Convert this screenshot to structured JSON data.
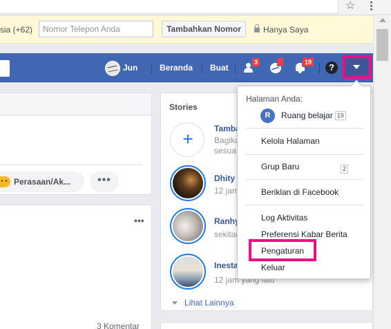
{
  "browser": {
    "star_icon": "star-icon",
    "menu_icon": "three-dot-menu-icon"
  },
  "notice": {
    "country_code_label": "sia (+62)",
    "phone_placeholder": "Nomor Telepon Anda",
    "add_number_button": "Tambahkan Nomor",
    "privacy_label": "Hanya Saya"
  },
  "header": {
    "profile_name": "Jun",
    "home_label": "Beranda",
    "create_label": "Buat",
    "friend_requests_count": "3",
    "messages_count": "",
    "notifications_count": "19",
    "help_label": "?"
  },
  "composer": {
    "feeling_label": "Perasaan/Ak...",
    "more_label": "•••"
  },
  "post": {
    "options_label": "•••",
    "comment_count": "3 Komentar"
  },
  "stories": {
    "title": "Stories",
    "add_story_title": "Tambah",
    "add_story_sub_1": "Bagika",
    "add_story_sub_2": "sesua",
    "items": [
      {
        "name": "Dhity",
        "time": "12 jam"
      },
      {
        "name": "Ranhy",
        "time": "sekitar"
      },
      {
        "name": "Inesta",
        "time": "12 jam yang lalu"
      }
    ],
    "see_more": "Lihat Lainnya"
  },
  "menu": {
    "your_pages_label": "Halaman Anda:",
    "page_initial": "R",
    "page_name": "Ruang belajar",
    "page_count": "19",
    "manage_pages": "Kelola Halaman",
    "new_group": "Grup Baru",
    "new_group_count": "2",
    "advertise": "Beriklan di Facebook",
    "activity_log": "Log Aktivitas",
    "news_feed_prefs": "Preferensi Kabar Berita",
    "settings": "Pengaturan",
    "logout": "Keluar"
  },
  "colors": {
    "fb_blue": "#4267b2",
    "highlight": "#ec0f82",
    "notice_bg": "#fff9d7"
  }
}
